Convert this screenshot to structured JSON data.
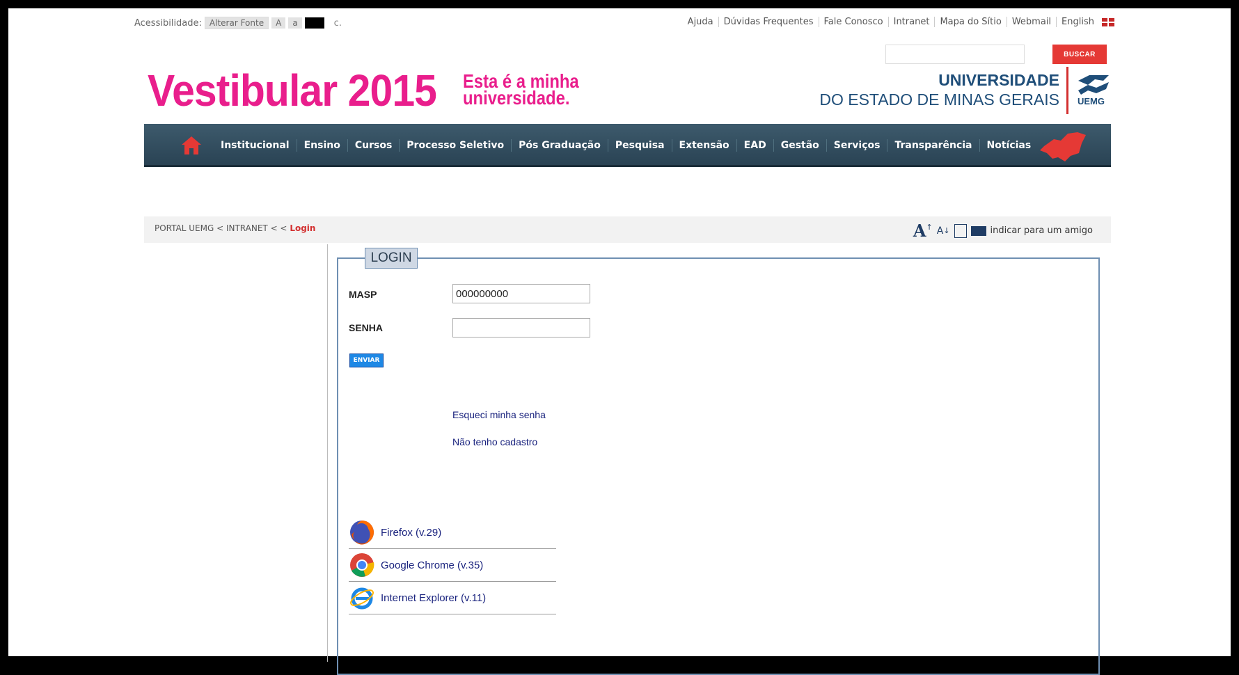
{
  "accessibility": {
    "label": "Acessibilidade:",
    "font_button": "Alterar Fonte",
    "font_large": "A",
    "font_small": "a",
    "contrast_suffix": "c."
  },
  "toplinks": [
    "Ajuda",
    "Dúvidas Frequentes",
    "Fale Conosco",
    "Intranet",
    "Mapa do Sítio",
    "Webmail",
    "English"
  ],
  "search": {
    "button": "BUSCAR",
    "value": ""
  },
  "banner": {
    "title": "Vestibular 2015",
    "tagline_line1": "Esta é a minha",
    "tagline_line2": "universidade."
  },
  "university": {
    "line1": "UNIVERSIDADE",
    "line2": "DO ESTADO DE MINAS GERAIS",
    "logo_text": "UEMG"
  },
  "nav": [
    "Institucional",
    "Ensino",
    "Cursos",
    "Processo Seletivo",
    "Pós Graduação",
    "Pesquisa",
    "Extensão",
    "EAD",
    "Gestão",
    "Serviços",
    "Transparência",
    "Notícias"
  ],
  "breadcrumb": {
    "path": "PORTAL UEMG < INTRANET < <",
    "current": "Login"
  },
  "tools": {
    "increase": "A",
    "decrease": "A",
    "recommend": "indicar para um amigo"
  },
  "login": {
    "legend": "LOGIN",
    "masp_label": "MASP",
    "masp_value": "000000000",
    "senha_label": "SENHA",
    "senha_value": "",
    "submit": "ENVIAR",
    "forgot": "Esqueci minha senha",
    "no_account": "Não tenho cadastro"
  },
  "browsers": [
    {
      "name": "Firefox (v.29)",
      "icon": "firefox-icon"
    },
    {
      "name": "Google Chrome (v.35)",
      "icon": "chrome-icon"
    },
    {
      "name": "Internet Explorer (v.11)",
      "icon": "ie-icon"
    }
  ],
  "colors": {
    "brand_pink": "#e91e8c",
    "nav_bg": "#2f4a5c",
    "uni_blue": "#1f4e79",
    "accent_red": "#e53935"
  }
}
